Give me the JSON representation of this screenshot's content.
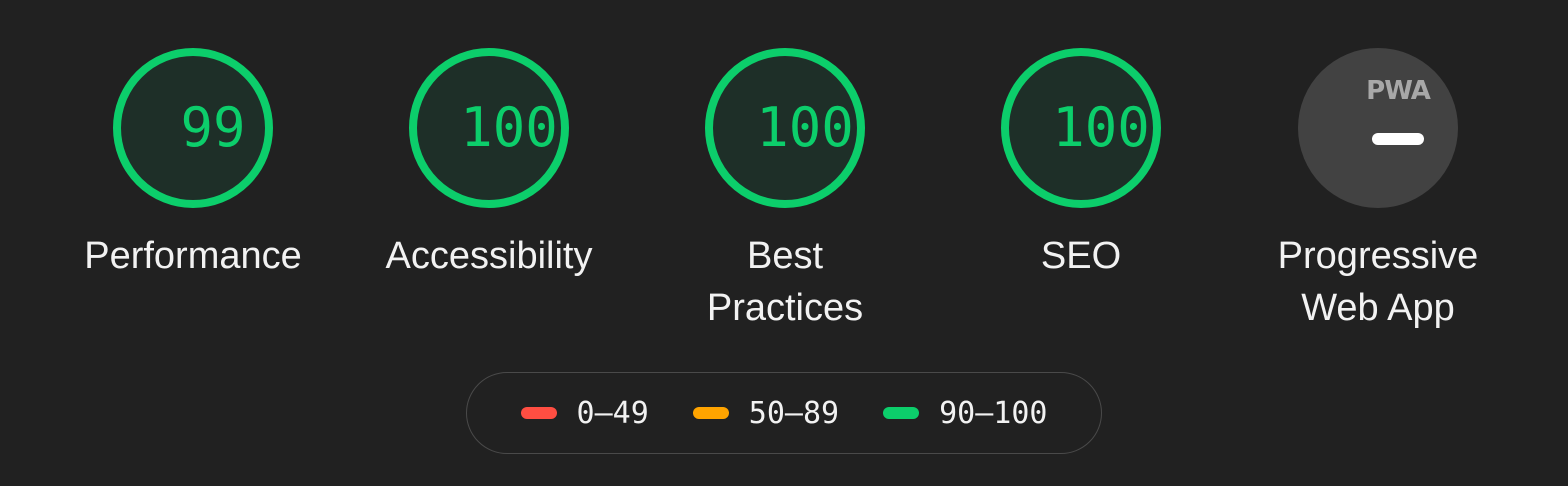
{
  "gauges": [
    {
      "name": "performance",
      "score": "99",
      "label": "Performance"
    },
    {
      "name": "accessibility",
      "score": "100",
      "label": "Accessibility"
    },
    {
      "name": "best-practices",
      "score": "100",
      "label": "Best Practices"
    },
    {
      "name": "seo",
      "score": "100",
      "label": "SEO"
    }
  ],
  "pwa": {
    "badge_text": "PWA",
    "label_line1": "Progressive",
    "label_line2": "Web App"
  },
  "legend": {
    "items": [
      {
        "label": "0–49",
        "color": "#ff4e42"
      },
      {
        "label": "50–89",
        "color": "#ffa400"
      },
      {
        "label": "90–100",
        "color": "#0cce6b"
      }
    ]
  },
  "colors": {
    "background": "#212121",
    "pass": "#0cce6b",
    "pwa_badge": "#424242"
  }
}
